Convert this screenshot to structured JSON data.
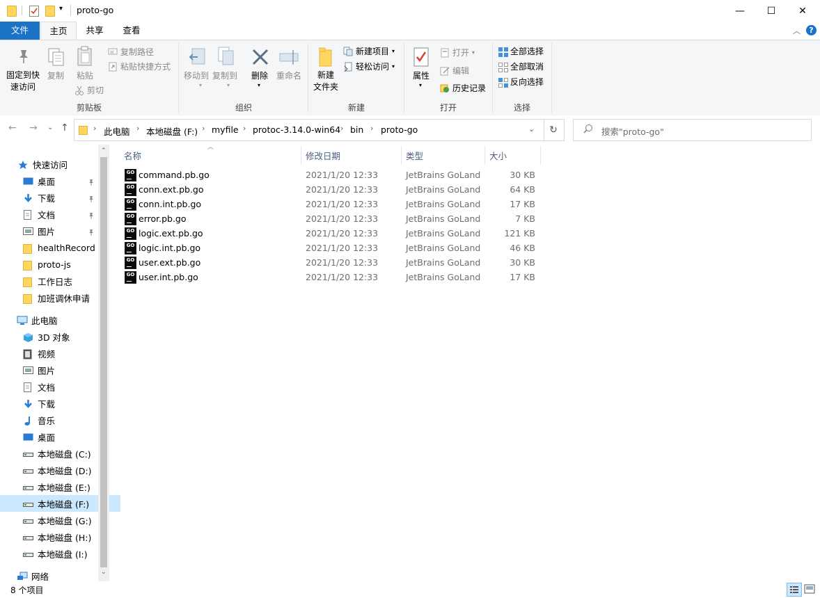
{
  "window": {
    "title": "proto-go",
    "minimize": "—",
    "maximize": "☐",
    "close": "✕"
  },
  "ribbon_tabs": {
    "file": "文件",
    "home": "主页",
    "share": "共享",
    "view": "查看"
  },
  "ribbon": {
    "clipboard": {
      "pin_label1": "固定到快",
      "pin_label2": "速访问",
      "copy": "复制",
      "paste": "粘贴",
      "copy_path": "复制路径",
      "paste_shortcut": "粘贴快捷方式",
      "cut": "剪切",
      "group": "剪贴板"
    },
    "organize": {
      "move_to": "移动到",
      "copy_to": "复制到",
      "delete": "删除",
      "rename": "重命名",
      "group": "组织"
    },
    "new": {
      "new_folder1": "新建",
      "new_folder2": "文件夹",
      "new_item": "新建项目",
      "easy_access": "轻松访问",
      "group": "新建"
    },
    "open": {
      "properties": "属性",
      "open": "打开",
      "edit": "编辑",
      "history": "历史记录",
      "group": "打开"
    },
    "select": {
      "select_all": "全部选择",
      "select_none": "全部取消",
      "invert": "反向选择",
      "group": "选择"
    }
  },
  "breadcrumb": [
    "此电脑",
    "本地磁盘 (F:)",
    "myfile",
    "protoc-3.14.0-win64",
    "bin",
    "proto-go"
  ],
  "search": {
    "placeholder": "搜索\"proto-go\""
  },
  "sidebar": {
    "quick_access": "快速访问",
    "quick_items": [
      {
        "label": "桌面",
        "icon": "desktop-icon",
        "pinned": true
      },
      {
        "label": "下载",
        "icon": "download-icon",
        "pinned": true
      },
      {
        "label": "文档",
        "icon": "document-icon",
        "pinned": true
      },
      {
        "label": "图片",
        "icon": "picture-icon",
        "pinned": true
      },
      {
        "label": "healthRecord",
        "icon": "folder-icon",
        "pinned": false
      },
      {
        "label": "proto-js",
        "icon": "folder-icon",
        "pinned": false
      },
      {
        "label": "工作日志",
        "icon": "folder-icon",
        "pinned": false
      },
      {
        "label": "加班调休申请",
        "icon": "folder-icon",
        "pinned": false
      }
    ],
    "this_pc": "此电脑",
    "pc_items": [
      {
        "label": "3D 对象",
        "icon": "3d-objects-icon"
      },
      {
        "label": "视频",
        "icon": "video-icon"
      },
      {
        "label": "图片",
        "icon": "picture-icon"
      },
      {
        "label": "文档",
        "icon": "document-icon"
      },
      {
        "label": "下载",
        "icon": "download-icon"
      },
      {
        "label": "音乐",
        "icon": "music-icon"
      },
      {
        "label": "桌面",
        "icon": "desktop-icon"
      },
      {
        "label": "本地磁盘 (C:)",
        "icon": "drive-icon"
      },
      {
        "label": "本地磁盘 (D:)",
        "icon": "drive-icon"
      },
      {
        "label": "本地磁盘 (E:)",
        "icon": "drive-icon"
      },
      {
        "label": "本地磁盘 (F:)",
        "icon": "drive-icon",
        "selected": true
      },
      {
        "label": "本地磁盘 (G:)",
        "icon": "drive-icon"
      },
      {
        "label": "本地磁盘 (H:)",
        "icon": "drive-icon"
      },
      {
        "label": "本地磁盘 (I:)",
        "icon": "drive-icon"
      }
    ],
    "network": "网络"
  },
  "columns": {
    "name": "名称",
    "modified": "修改日期",
    "type": "类型",
    "size": "大小"
  },
  "files": [
    {
      "name": "command.pb.go",
      "modified": "2021/1/20 12:33",
      "type": "JetBrains GoLand",
      "size": "30 KB"
    },
    {
      "name": "conn.ext.pb.go",
      "modified": "2021/1/20 12:33",
      "type": "JetBrains GoLand",
      "size": "64 KB"
    },
    {
      "name": "conn.int.pb.go",
      "modified": "2021/1/20 12:33",
      "type": "JetBrains GoLand",
      "size": "17 KB"
    },
    {
      "name": "error.pb.go",
      "modified": "2021/1/20 12:33",
      "type": "JetBrains GoLand",
      "size": "7 KB"
    },
    {
      "name": "logic.ext.pb.go",
      "modified": "2021/1/20 12:33",
      "type": "JetBrains GoLand",
      "size": "121 KB"
    },
    {
      "name": "logic.int.pb.go",
      "modified": "2021/1/20 12:33",
      "type": "JetBrains GoLand",
      "size": "46 KB"
    },
    {
      "name": "user.ext.pb.go",
      "modified": "2021/1/20 12:33",
      "type": "JetBrains GoLand",
      "size": "30 KB"
    },
    {
      "name": "user.int.pb.go",
      "modified": "2021/1/20 12:33",
      "type": "JetBrains GoLand",
      "size": "17 KB"
    }
  ],
  "status": {
    "count": "8 个项目"
  },
  "colors": {
    "accent": "#1a73c7",
    "selection": "#cce8ff",
    "folder": "#ffd75e"
  }
}
